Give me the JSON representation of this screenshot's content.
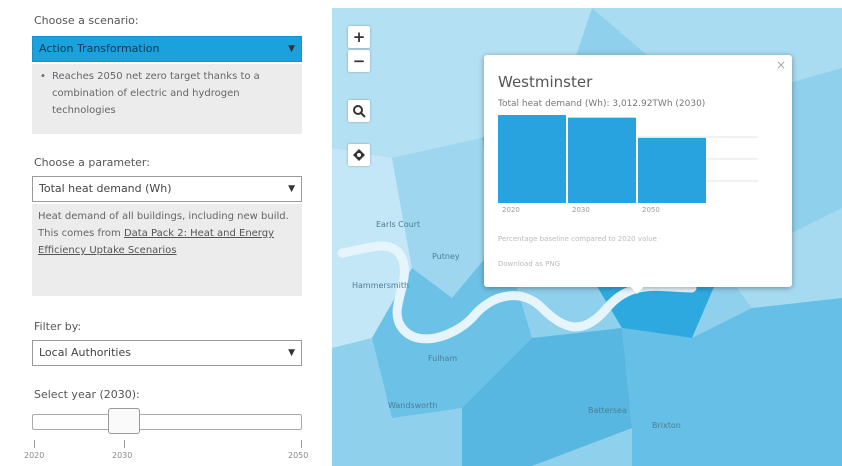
{
  "sidebar": {
    "scenario_label": "Choose a scenario:",
    "scenario_value": "Action Transformation",
    "scenario_desc": "Reaches 2050 net zero target thanks to a combination of electric and hydrogen technologies",
    "parameter_label": "Choose a parameter:",
    "parameter_value": "Total heat demand (Wh)",
    "parameter_desc_pre": "Heat demand of all buildings, including new build. This comes from ",
    "parameter_desc_link": "Data Pack 2: Heat and Energy Efficiency Uptake Scenarios",
    "filter_label": "Filter by:",
    "filter_value": "Local Authorities",
    "year_label": "Select year (2030):",
    "year_value": 2030,
    "year_min": 2020,
    "year_max": 2050,
    "ticks": [
      "2020",
      "2030",
      "2050"
    ]
  },
  "map": {
    "zoom_in": "+",
    "zoom_out": "−",
    "search_icon": "search-icon",
    "locate_icon": "locate-icon",
    "places": [
      "Hammersmith",
      "Fulham",
      "Earls Court",
      "Putney",
      "Wandsworth",
      "Battersea",
      "Brixton"
    ],
    "colors": {
      "water": "#7ec9e8",
      "region_light": "#b4e0f3",
      "region_mid": "#5ab8e1",
      "region_dark": "#1ba1dc"
    }
  },
  "popup": {
    "close": "×",
    "title": "Westminster",
    "subtitle": "Total heat demand (Wh): 3,012.92TWh (2030)",
    "footnote": "Percentage baseline compared to 2020 value",
    "link": "Download as PNG",
    "chart_data": {
      "type": "bar",
      "categories": [
        "2020",
        "2030",
        "2050"
      ],
      "values": [
        100,
        97,
        74
      ],
      "ylim": [
        0,
        100
      ],
      "grid": true,
      "color": "#29a3e0"
    }
  }
}
